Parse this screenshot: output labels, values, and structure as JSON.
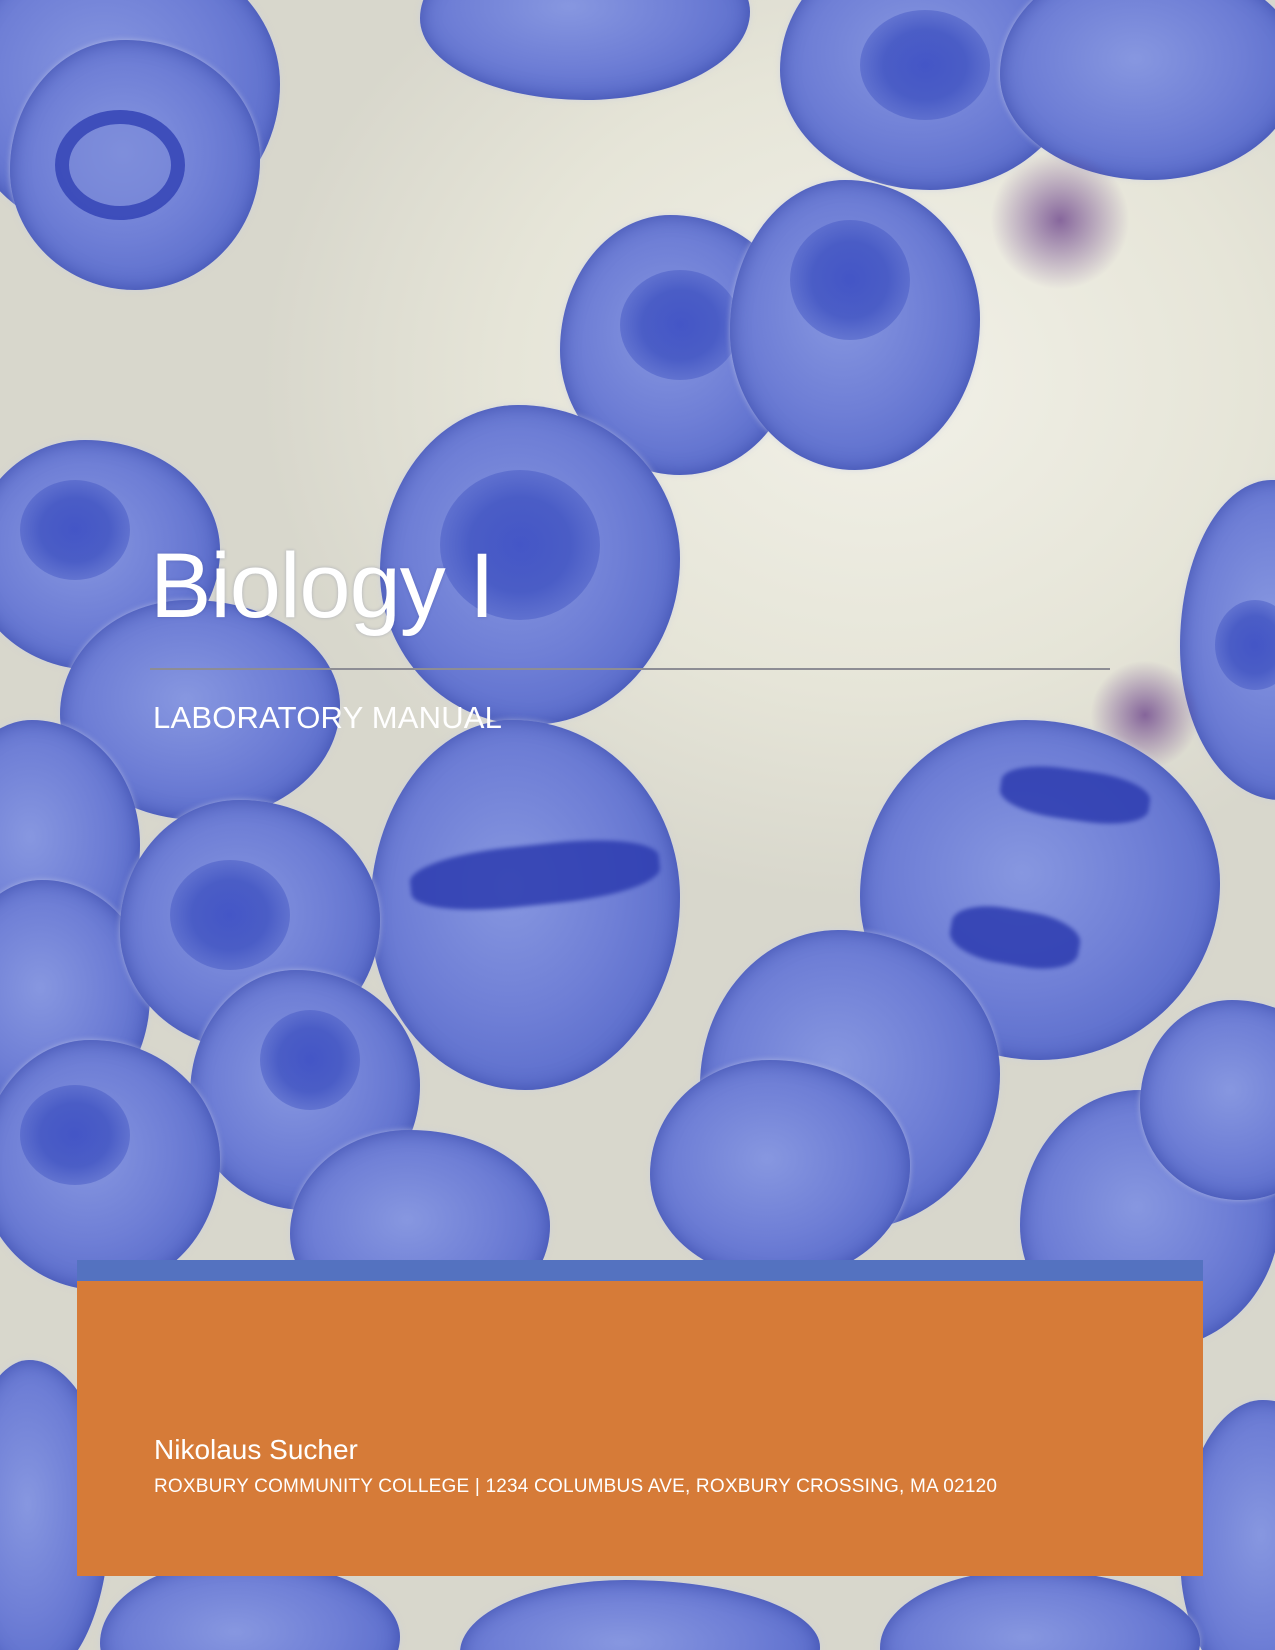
{
  "cover": {
    "title": "Biology I",
    "subtitle": "LABORATORY MANUAL"
  },
  "footer": {
    "author": "Nikolaus Sucher",
    "address": "ROXBURY COMMUNITY COLLEGE | 1234 COLUMBUS AVE, ROXBURY CROSSING, MA 02120"
  },
  "colors": {
    "footer_background": "#d67b38",
    "footer_accent_bar": "#5472c0",
    "title_text": "#ffffff",
    "rule": "#8d8d94"
  },
  "background_image": "micrograph of blue-stained dividing cells"
}
